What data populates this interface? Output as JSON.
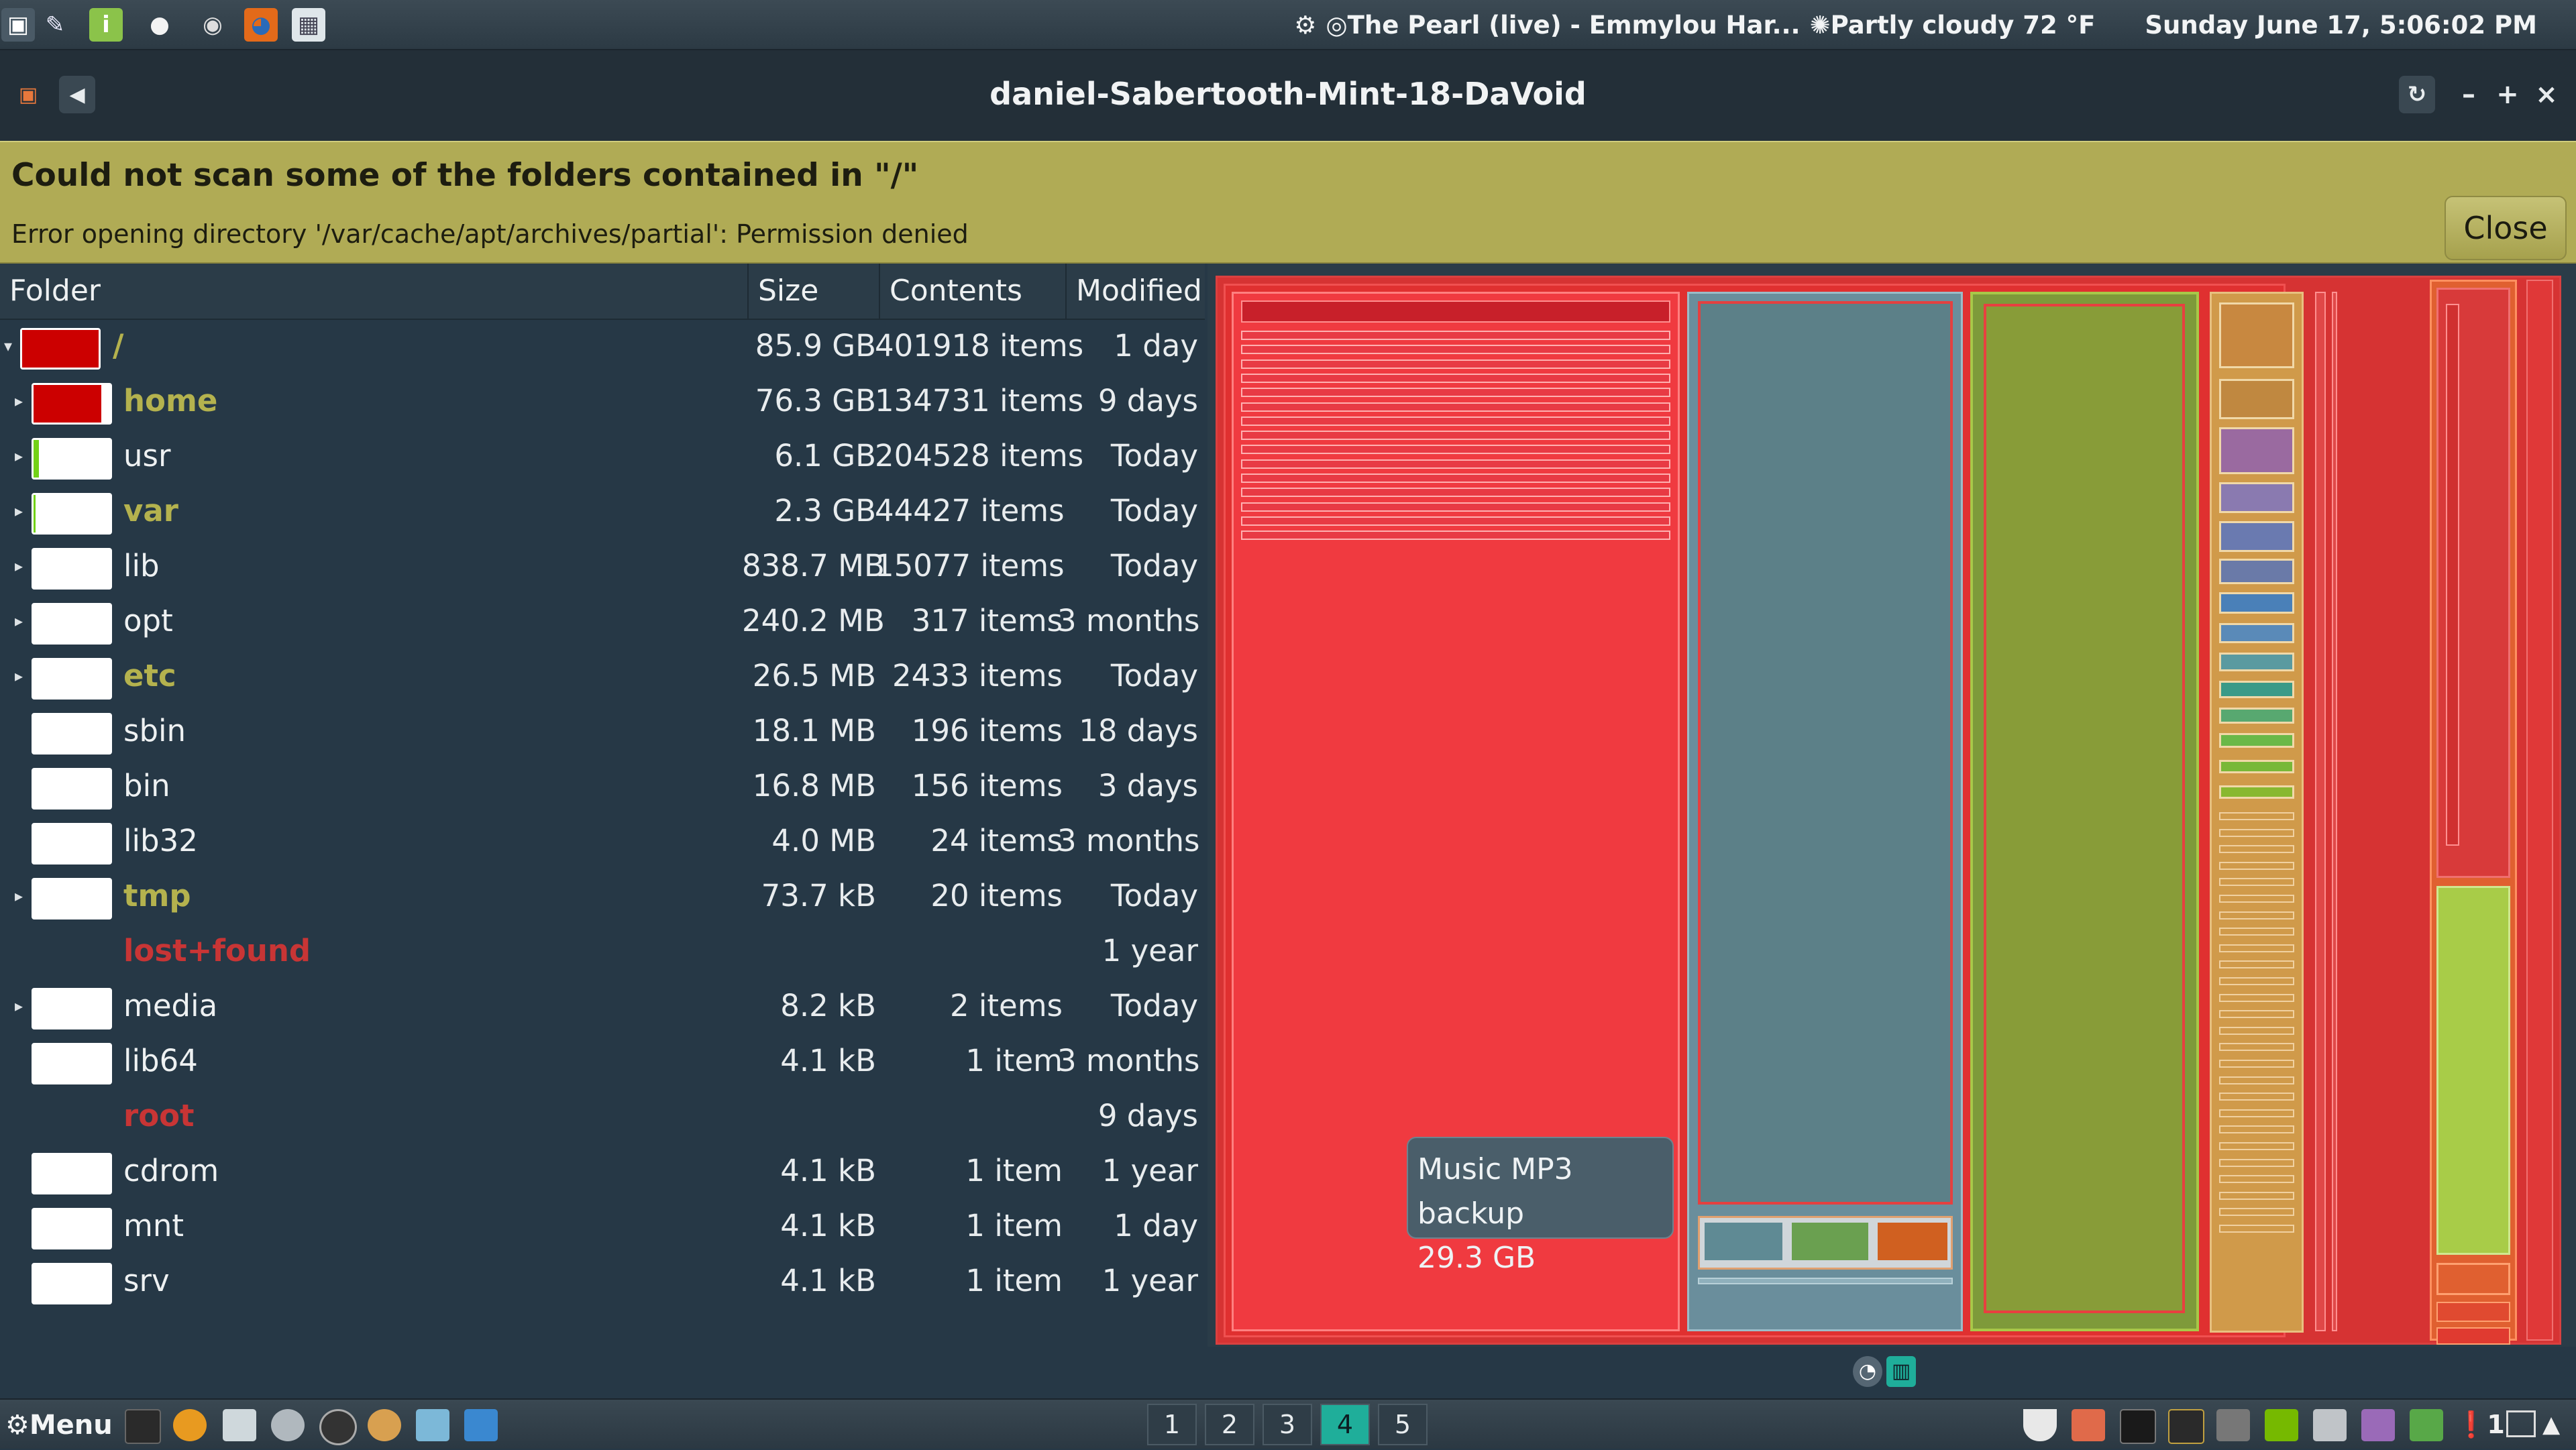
{
  "top_panel": {
    "icons_left": [
      "app-launcher-icon",
      "pen-tool-icon",
      "info-app-icon",
      "user-icon",
      "disc-icon",
      "firefox-icon",
      "screenshot-icon"
    ],
    "settings_icon": "gear-icon",
    "now_playing": "The Pearl (live) - Emmylou Har...",
    "weather": "Partly cloudy 72 °F",
    "datetime": "Sunday June 17,  5:06:02 PM"
  },
  "window": {
    "title": "daniel-Sabertooth-Mint-18-DaVoid",
    "buttons": [
      "refresh-icon",
      "minimize-icon",
      "maximize-icon",
      "close-icon"
    ]
  },
  "infobar": {
    "title": "Could not scan some of the folders contained in \"/\"",
    "message": "Error opening directory '/var/cache/apt/archives/partial': Permission denied",
    "close_label": "Close"
  },
  "columns": [
    "Folder",
    "Size",
    "Contents",
    "Modified"
  ],
  "rows": [
    {
      "name": "/",
      "size": "85.9 GB",
      "contents": "401918 items",
      "modified": "1 day",
      "fill": 1.0,
      "color": "#cc0000",
      "expand": "open",
      "style": "warn",
      "indent": 0
    },
    {
      "name": "home",
      "size": "76.3 GB",
      "contents": "134731 items",
      "modified": "9 days",
      "fill": 0.888,
      "color": "#cc0000",
      "expand": "closed",
      "style": "warn",
      "indent": 1
    },
    {
      "name": "usr",
      "size": "6.1 GB",
      "contents": "204528 items",
      "modified": "Today",
      "fill": 0.071,
      "color": "#73d216",
      "expand": "closed",
      "style": "normal",
      "indent": 1
    },
    {
      "name": "var",
      "size": "2.3 GB",
      "contents": "44427 items",
      "modified": "Today",
      "fill": 0.027,
      "color": "#73d216",
      "expand": "closed",
      "style": "warn",
      "indent": 1
    },
    {
      "name": "lib",
      "size": "838.7 MB",
      "contents": "15077 items",
      "modified": "Today",
      "fill": 0.0,
      "color": "#ffffff",
      "expand": "closed",
      "style": "normal",
      "indent": 1
    },
    {
      "name": "opt",
      "size": "240.2 MB",
      "contents": "317 items",
      "modified": "3 months",
      "fill": 0.0,
      "color": "#ffffff",
      "expand": "closed",
      "style": "normal",
      "indent": 1
    },
    {
      "name": "etc",
      "size": "26.5 MB",
      "contents": "2433 items",
      "modified": "Today",
      "fill": 0.0,
      "color": "#ffffff",
      "expand": "closed",
      "style": "warn",
      "indent": 1
    },
    {
      "name": "sbin",
      "size": "18.1 MB",
      "contents": "196 items",
      "modified": "18 days",
      "fill": 0.0,
      "color": "#ffffff",
      "expand": "none",
      "style": "normal",
      "indent": 1
    },
    {
      "name": "bin",
      "size": "16.8 MB",
      "contents": "156 items",
      "modified": "3 days",
      "fill": 0.0,
      "color": "#ffffff",
      "expand": "none",
      "style": "normal",
      "indent": 1
    },
    {
      "name": "lib32",
      "size": "4.0 MB",
      "contents": "24 items",
      "modified": "3 months",
      "fill": 0.0,
      "color": "#ffffff",
      "expand": "none",
      "style": "normal",
      "indent": 1
    },
    {
      "name": "tmp",
      "size": "73.7 kB",
      "contents": "20 items",
      "modified": "Today",
      "fill": 0.0,
      "color": "#ffffff",
      "expand": "closed",
      "style": "warn",
      "indent": 1
    },
    {
      "name": "lost+found",
      "size": "",
      "contents": "",
      "modified": "1 year",
      "fill": null,
      "color": "",
      "expand": "none",
      "style": "error",
      "indent": 1
    },
    {
      "name": "media",
      "size": "8.2 kB",
      "contents": "2 items",
      "modified": "Today",
      "fill": 0.0,
      "color": "#ffffff",
      "expand": "closed",
      "style": "normal",
      "indent": 1
    },
    {
      "name": "lib64",
      "size": "4.1 kB",
      "contents": "1 item",
      "modified": "3 months",
      "fill": 0.0,
      "color": "#ffffff",
      "expand": "none",
      "style": "normal",
      "indent": 1
    },
    {
      "name": "root",
      "size": "",
      "contents": "",
      "modified": "9 days",
      "fill": null,
      "color": "",
      "expand": "none",
      "style": "error",
      "indent": 1
    },
    {
      "name": "cdrom",
      "size": "4.1 kB",
      "contents": "1 item",
      "modified": "1 year",
      "fill": 0.0,
      "color": "#ffffff",
      "expand": "none",
      "style": "normal",
      "indent": 1
    },
    {
      "name": "mnt",
      "size": "4.1 kB",
      "contents": "1 item",
      "modified": "1 day",
      "fill": 0.0,
      "color": "#ffffff",
      "expand": "none",
      "style": "normal",
      "indent": 1
    },
    {
      "name": "srv",
      "size": "4.1 kB",
      "contents": "1 item",
      "modified": "1 year",
      "fill": 0.0,
      "color": "#ffffff",
      "expand": "none",
      "style": "normal",
      "indent": 1
    }
  ],
  "tooltip": {
    "name": "Music MP3 backup",
    "size": "29.3 GB"
  },
  "map_mode_icons": [
    "ring-chart-icon",
    "treemap-icon"
  ],
  "bottom_panel": {
    "menu_label": "Menu",
    "menu_icon": "gear-icon",
    "launchers": [
      "terminal-icon",
      "vlc-icon",
      "screenshot-icon",
      "wine-icon",
      "disc-icon",
      "audio-icon",
      "folder-icon",
      "bluefish-icon"
    ],
    "workspaces": [
      "1",
      "2",
      "3",
      "4",
      "5"
    ],
    "active_workspace": "4",
    "tray_icons": [
      "shield-icon",
      "image-viewer-icon",
      "terminal-icon",
      "system-monitor-icon",
      "settings-icon",
      "nvidia-icon",
      "drive-icon",
      "tuning-fork-icon",
      "chat-icon"
    ],
    "notification_count": "1",
    "tray_end": [
      "display-icon",
      "up-arrow-icon"
    ]
  },
  "colors": {
    "warn_text": "#b4b24e",
    "error_text": "#c83535",
    "accent": "#1fae9a",
    "infobar": "#b0ab55"
  }
}
